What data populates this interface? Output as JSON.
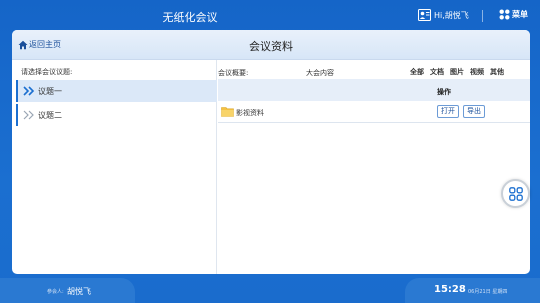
{
  "app": {
    "title": "无纸化会议",
    "user_label": "Hi,胡悦飞",
    "menu_label": "菜单"
  },
  "header": {
    "back_label": "返回主页",
    "page_title": "会议资料"
  },
  "topics": {
    "prompt": "请选择会议议题:",
    "items": [
      {
        "label": "议题一",
        "active": true
      },
      {
        "label": "议题二",
        "active": false
      }
    ]
  },
  "content": {
    "overview_label": "会议概要:",
    "overview_value": "大会内容",
    "filter_tabs": [
      "全部",
      "文档",
      "图片",
      "视频",
      "其他"
    ],
    "active_filter": "全部",
    "columns": {
      "ops": "操作"
    },
    "files": [
      {
        "name": "影视资料",
        "type": "folder",
        "actions": [
          "打开",
          "导出"
        ]
      }
    ]
  },
  "footer": {
    "participants_label": "参会人:",
    "participants_value": "胡悦飞",
    "time": "15:28",
    "date": "06月21日 星期四"
  },
  "colors": {
    "brand_blue": "#1b6fd0",
    "folder_yellow": "#f5c242"
  },
  "icons": {
    "user": "user-card-icon",
    "menu": "menu-grid-icon",
    "back": "home-icon",
    "topic_active": "double-chevron-icon",
    "topic_inactive": "double-chevron-icon",
    "file": "folder-icon",
    "fab": "apps-icon"
  }
}
